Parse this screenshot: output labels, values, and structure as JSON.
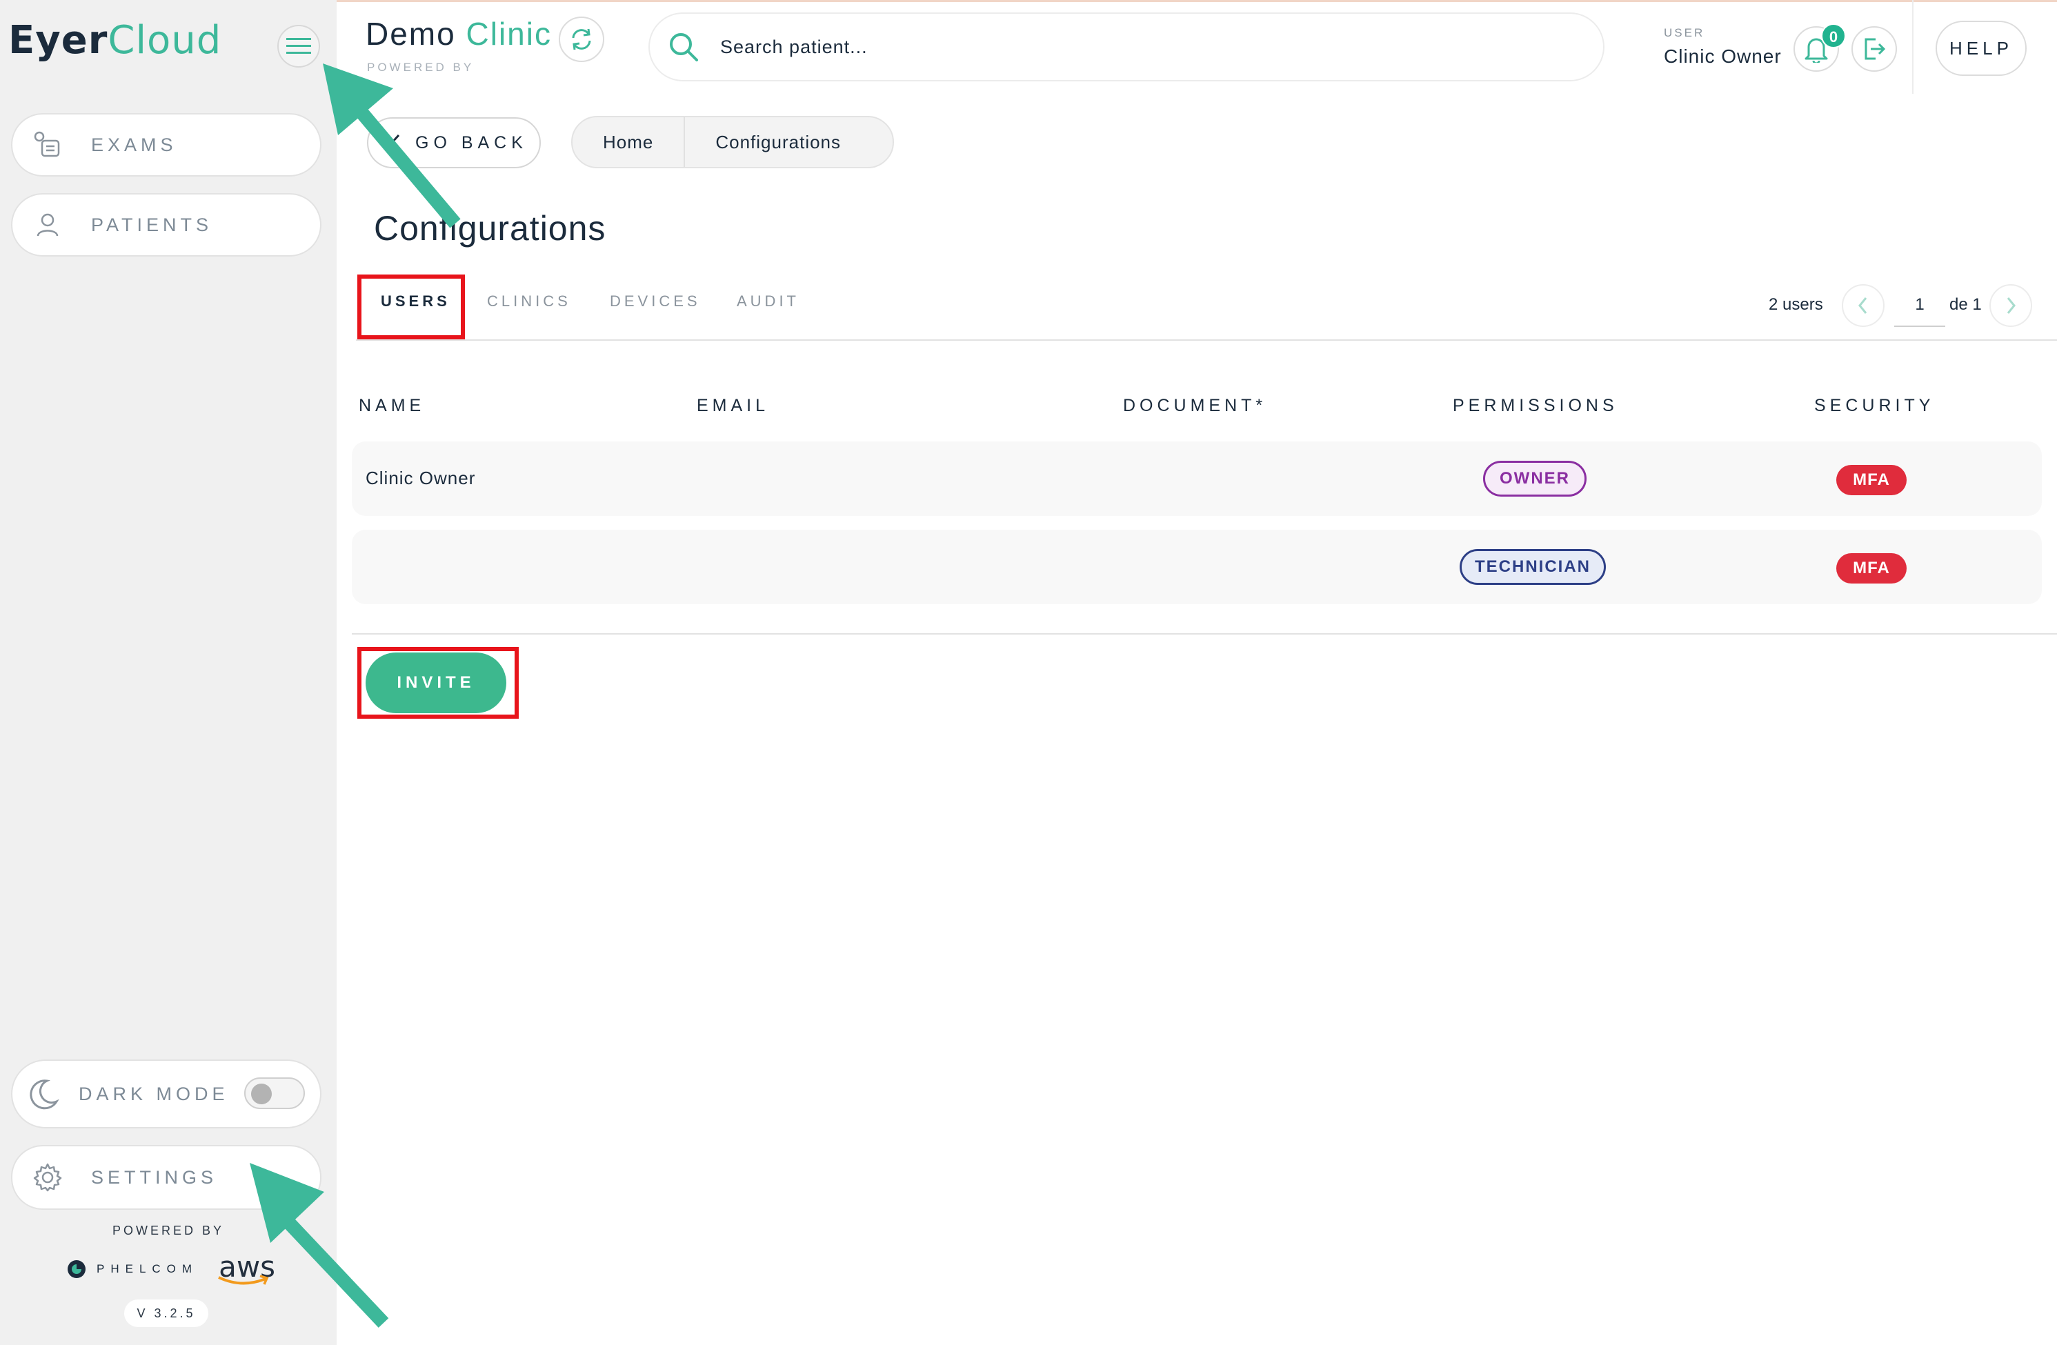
{
  "app": {
    "logo_part1": "Eyer",
    "logo_part2": "Cloud"
  },
  "sidebar": {
    "items": [
      {
        "label": "EXAMS",
        "icon": "exams-icon"
      },
      {
        "label": "PATIENTS",
        "icon": "patient-icon"
      }
    ],
    "dark_mode_label": "DARK MODE",
    "dark_mode_on": false,
    "settings_label": "SETTINGS",
    "powered_by": "POWERED BY",
    "phelcom": "PHELCOM",
    "aws": "aws",
    "version": "V 3.2.5"
  },
  "header": {
    "clinic_part1": "Demo",
    "clinic_part2": "Clinic",
    "powered_by": "POWERED BY",
    "search_placeholder": "Search patient...",
    "user_caption": "USER",
    "user_name": "Clinic Owner",
    "notification_count": "0",
    "help_label": "HELP"
  },
  "nav": {
    "go_back_label": "GO BACK",
    "breadcrumb": [
      "Home",
      "Configurations"
    ]
  },
  "page": {
    "title": "Configurations",
    "tabs": [
      {
        "label": "USERS",
        "active": true
      },
      {
        "label": "CLINICS",
        "active": false
      },
      {
        "label": "DEVICES",
        "active": false
      },
      {
        "label": "AUDIT",
        "active": false
      }
    ],
    "users_count": "2 users",
    "page_current": "1",
    "page_of": "de 1"
  },
  "table": {
    "headers": [
      "NAME",
      "EMAIL",
      "DOCUMENT*",
      "PERMISSIONS",
      "SECURITY"
    ],
    "rows": [
      {
        "name": "Clinic Owner",
        "email": "",
        "document": "",
        "permission": "OWNER",
        "security": "MFA"
      },
      {
        "name": "",
        "email": "",
        "document": "",
        "permission": "TECHNICIAN",
        "security": "MFA"
      }
    ],
    "invite_label": "INVITE"
  },
  "colors": {
    "accent": "#3db89a",
    "highlight_box": "#e8141b",
    "annotation_arrow": "#3db89a",
    "mfa_badge": "#e02c3c",
    "owner_badge": "#8a2ea1",
    "technician_badge": "#2d3f86"
  }
}
